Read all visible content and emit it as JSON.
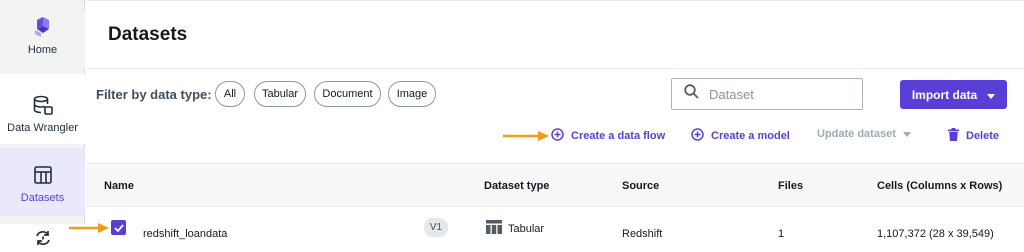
{
  "sidebar": {
    "items": [
      {
        "label": "Home",
        "icon": "home-logo-icon"
      },
      {
        "label": "Data Wrangler",
        "icon": "database-icon"
      },
      {
        "label": "Datasets",
        "icon": "table-icon",
        "active": true
      },
      {
        "label": "",
        "icon": "refresh-icon"
      }
    ]
  },
  "page": {
    "title": "Datasets"
  },
  "filter": {
    "label": "Filter by data type:",
    "chips": [
      "All",
      "Tabular",
      "Document",
      "Image"
    ]
  },
  "search": {
    "placeholder": "Dataset",
    "value": ""
  },
  "toolbar": {
    "import_label": "Import data",
    "create_flow": "Create a data flow",
    "create_model": "Create a model",
    "update_dataset": "Update dataset",
    "delete": "Delete"
  },
  "table": {
    "headers": {
      "name": "Name",
      "type": "Dataset type",
      "source": "Source",
      "files": "Files",
      "cells": "Cells (Columns x Rows)"
    },
    "rows": [
      {
        "name": "redshift_loandata",
        "version": "V1",
        "type": "Tabular",
        "source": "Redshift",
        "files": "1",
        "cells": "1,107,372 (28 x 39,549)",
        "selected": true
      }
    ]
  },
  "colors": {
    "accent": "#5a3fd6",
    "annotation_arrow": "#f59b1a",
    "sidebar_bg": "#f2f3f3",
    "active_bg": "#eae8fb"
  }
}
